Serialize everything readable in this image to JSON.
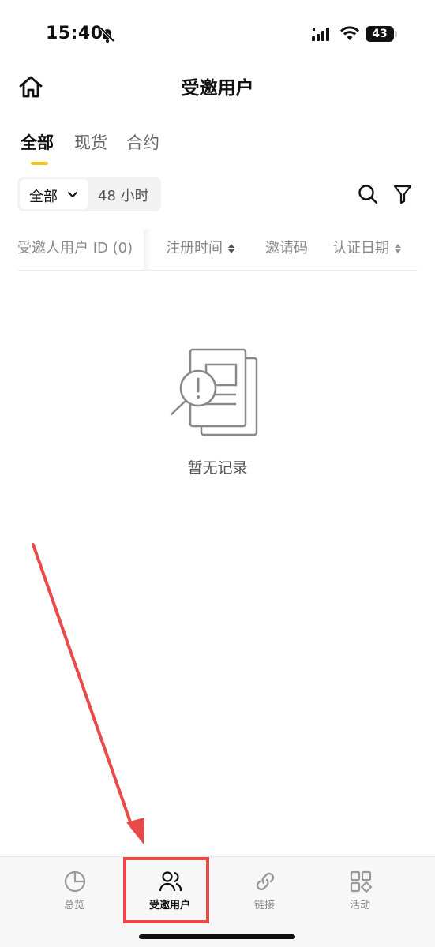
{
  "status_bar": {
    "time": "15:40",
    "battery": "43",
    "icons": [
      "bell-slash-icon",
      "signal-icon",
      "wifi-icon",
      "battery-icon"
    ]
  },
  "header": {
    "title": "受邀用户",
    "home_icon": "home-icon"
  },
  "tabs": [
    {
      "label": "全部",
      "active": true
    },
    {
      "label": "现货",
      "active": false
    },
    {
      "label": "合约",
      "active": false
    }
  ],
  "filters": {
    "select_label": "全部",
    "time_range": "48 小时"
  },
  "table": {
    "columns": [
      {
        "label": "受邀人用户 ID (0)"
      },
      {
        "label": "注册时间",
        "sortable": true
      },
      {
        "label": "邀请码"
      },
      {
        "label": "认证日期",
        "sortable": true
      }
    ]
  },
  "empty_state": {
    "text": "暂无记录"
  },
  "bottom_nav": {
    "items": [
      {
        "label": "总览",
        "icon": "pie-chart-icon",
        "active": false
      },
      {
        "label": "受邀用户",
        "icon": "users-icon",
        "active": true
      },
      {
        "label": "链接",
        "icon": "link-icon",
        "active": false
      },
      {
        "label": "活动",
        "icon": "apps-grid-icon",
        "active": false
      }
    ]
  },
  "colors": {
    "accent": "#f5c518",
    "annotation": "#e84a4a",
    "text_primary": "#111111",
    "text_secondary": "#888888"
  }
}
